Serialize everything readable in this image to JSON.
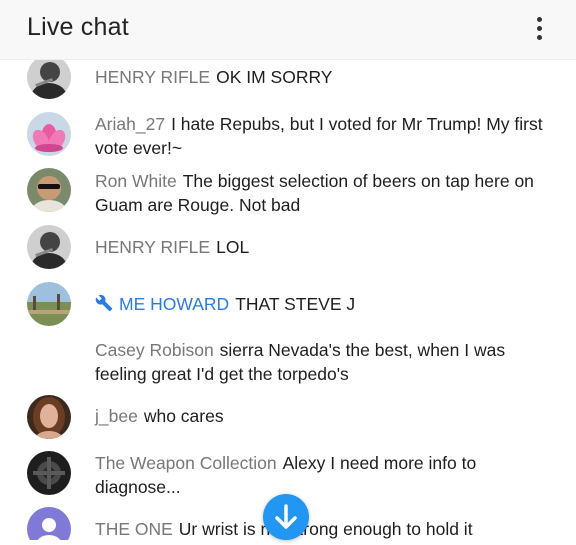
{
  "header": {
    "title": "Live chat",
    "menu_icon": "more-vert-icon"
  },
  "messages": [
    {
      "author": "HENRY RIFLE",
      "text": "OK IM SORRY",
      "avatar": "bw-portrait-avatar"
    },
    {
      "author": "Ariah_27",
      "text": "I hate Repubs, but I voted for Mr Trump! My first vote ever!~",
      "avatar": "pink-lotus-avatar"
    },
    {
      "author": "Ron White",
      "text": "The biggest selection of beers on tap here on Guam are Rouge. Not bad",
      "avatar": "sunglasses-portrait-avatar"
    },
    {
      "author": "HENRY RIFLE",
      "text": "LOL",
      "avatar": "bw-portrait-avatar"
    },
    {
      "author": "ME HOWARD",
      "text": "THAT STEVE J",
      "avatar": "landscape-avatar",
      "moderator": true,
      "badge_icon": "wrench-icon"
    },
    {
      "author": "Casey Robison",
      "text": "sierra Nevada's the best, when I was feeling great I'd get the torpedo's",
      "avatar": ""
    },
    {
      "author": "j_bee",
      "text": "who cares",
      "avatar": "woman-portrait-avatar"
    },
    {
      "author": "The Weapon Collection",
      "text": "Alexy I need more info to diagnose...",
      "avatar": "dark-gear-avatar"
    },
    {
      "author": "THE ONE",
      "text": "Ur wrist is not strong enough to hold it",
      "avatar": "default-person-avatar"
    }
  ],
  "scroll_button": {
    "icon": "arrow-down-icon"
  },
  "colors": {
    "moderator": "#2a7be4",
    "author": "#777777",
    "accent": "#2196f3"
  }
}
